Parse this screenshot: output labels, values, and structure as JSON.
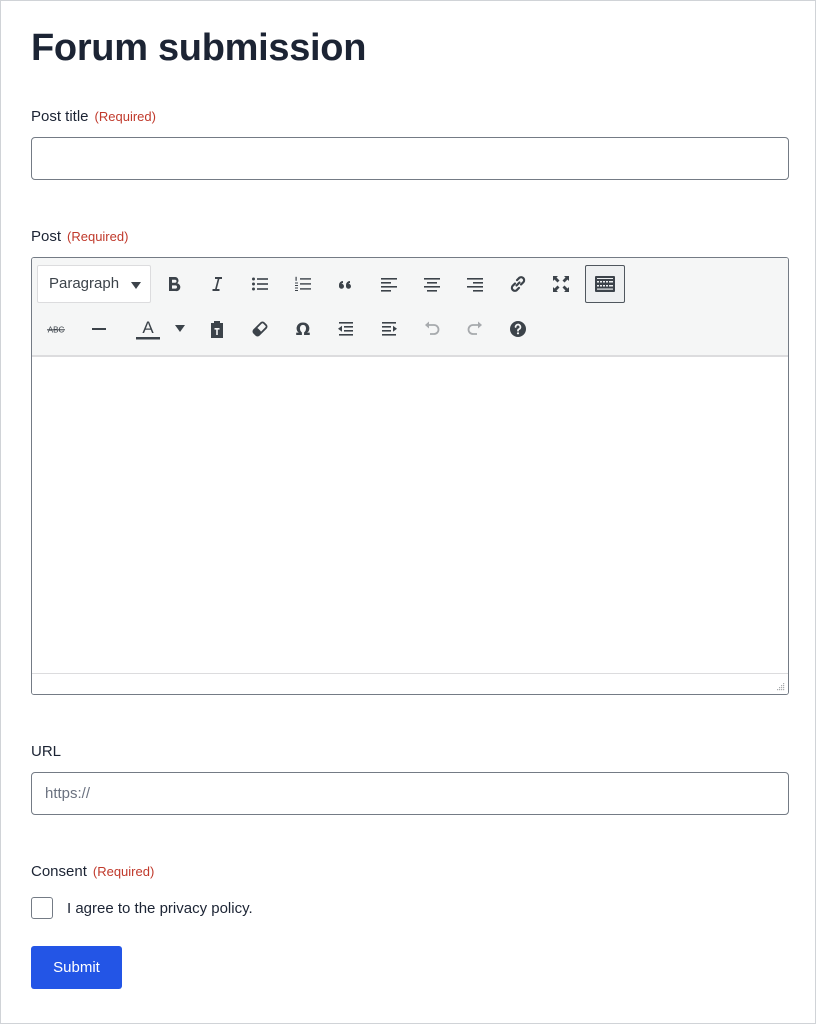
{
  "form": {
    "title": "Forum submission",
    "required_text": "(Required)",
    "post_title": {
      "label": "Post title",
      "value": ""
    },
    "post": {
      "label": "Post",
      "format_select": "Paragraph",
      "toolbar_row1": [
        "bold-icon",
        "italic-icon",
        "bulleted-list-icon",
        "numbered-list-icon",
        "blockquote-icon",
        "align-left-icon",
        "align-center-icon",
        "align-right-icon",
        "link-icon",
        "fullscreen-icon",
        "toolbar-toggle-icon"
      ],
      "toolbar_row2": [
        "strikethrough-icon",
        "horizontal-line-icon",
        "text-color-icon",
        "text-color-dropdown-icon",
        "paste-as-text-icon",
        "clear-formatting-icon",
        "special-character-icon",
        "decrease-indent-icon",
        "increase-indent-icon",
        "undo-icon",
        "redo-icon",
        "help-icon"
      ],
      "strike_glyph": "ABC",
      "text_color_glyph": "A",
      "special_char_glyph": "Ω",
      "content": ""
    },
    "url": {
      "label": "URL",
      "placeholder": "https://",
      "value": ""
    },
    "consent": {
      "label": "Consent",
      "checkbox_label": "I agree to the privacy policy.",
      "checked": false
    },
    "submit_label": "Submit"
  },
  "colors": {
    "accent": "#2355e6",
    "required": "#c0392b",
    "text": "#1c2434"
  }
}
